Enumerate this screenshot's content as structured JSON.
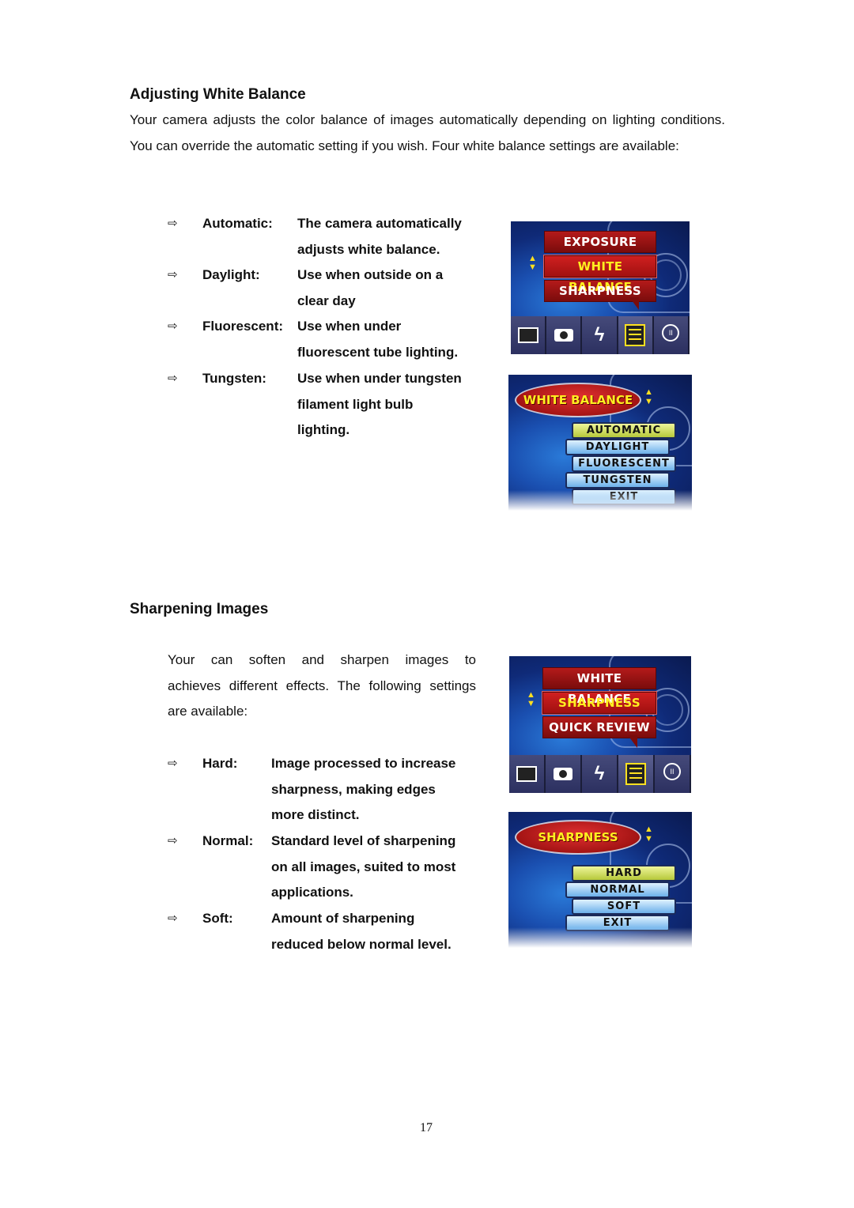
{
  "white_balance": {
    "heading": "Adjusting White Balance",
    "intro": "Your camera adjusts the color balance of images automatically depending on lighting conditions. You can override the automatic setting if you wish. Four white balance settings are available:",
    "bullets": [
      {
        "term": "Automatic:",
        "lines": [
          "The camera automatically",
          "adjusts white balance."
        ]
      },
      {
        "term": "Daylight:",
        "lines": [
          "Use when outside on a",
          "clear day"
        ]
      },
      {
        "term": "Fluorescent:",
        "lines": [
          "Use when under",
          "fluorescent tube lighting."
        ]
      },
      {
        "term": "Tungsten:",
        "lines": [
          "Use when under tungsten",
          "filament light bulb",
          "lighting."
        ]
      }
    ],
    "screen_menu": {
      "items": [
        "EXPOSURE",
        "WHITE BALANCE",
        "SHARPNESS"
      ],
      "selected": "WHITE BALANCE",
      "icons": [
        "frame-icon",
        "camera-icon",
        "flash-icon",
        "menu-list-icon",
        "bulb-icon"
      ]
    },
    "screen_options": {
      "title": "WHITE BALANCE",
      "options": [
        "AUTOMATIC",
        "DAYLIGHT",
        "FLUORESCENT",
        "TUNGSTEN",
        "EXIT"
      ],
      "selected": "AUTOMATIC"
    }
  },
  "sharpening": {
    "heading": "Sharpening Images",
    "intro_lines": [
      "Your can soften and sharpen images to",
      "achieves different effects. The following settings",
      "are available:"
    ],
    "bullets": [
      {
        "term": "Hard:",
        "lines": [
          "Image processed to increase",
          "sharpness, making edges",
          "more distinct."
        ]
      },
      {
        "term": "Normal:",
        "lines": [
          "Standard level of sharpening",
          "on all images, suited to most",
          "applications."
        ]
      },
      {
        "term": "Soft:",
        "lines": [
          "Amount of sharpening",
          "reduced below normal level."
        ]
      }
    ],
    "screen_menu": {
      "items": [
        "WHITE BALANCE",
        "SHARPNESS",
        "QUICK REVIEW"
      ],
      "selected": "SHARPNESS",
      "icons": [
        "frame-icon",
        "camera-icon",
        "flash-icon",
        "menu-list-icon",
        "bulb-icon"
      ]
    },
    "screen_options": {
      "title": "SHARPNESS",
      "options": [
        "HARD",
        "NORMAL",
        "SOFT",
        "EXIT"
      ],
      "selected": "HARD"
    }
  },
  "arrow_glyph": "⇨",
  "page_number": "17"
}
